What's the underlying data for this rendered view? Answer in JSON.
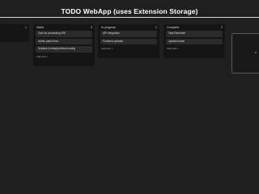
{
  "app": {
    "title": "TODO WebApp (uses Extension Storage)"
  },
  "columns": [
    {
      "title": "",
      "count": "1",
      "cards": [],
      "add_label": ""
    },
    {
      "title": "Webb",
      "count": "3",
      "cards": [
        "Guts for processing SRI",
        "Admin panel fixes",
        "Subtask & timeglow/fixed sorting"
      ],
      "add_label": "Add card  +"
    },
    {
      "title": "In progress",
      "count": "2",
      "cards": [
        "API integration",
        "Frontend updated"
      ],
      "add_label": "Add card  +"
    },
    {
      "title": "Complete",
      "count": "2",
      "cards": [
        "Task Reminder",
        "updated same"
      ],
      "add_label": "Add card  +"
    }
  ]
}
